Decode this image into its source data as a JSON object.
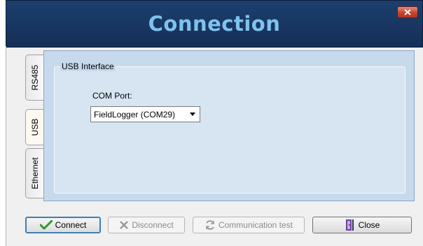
{
  "window": {
    "title": "Connection"
  },
  "tabs": [
    {
      "label": "RS485",
      "active": false
    },
    {
      "label": "USB",
      "active": true
    },
    {
      "label": "Ethernet",
      "active": false
    }
  ],
  "usb": {
    "group_title": "USB Interface",
    "com_port_label": "COM Port:",
    "com_port_value": "FieldLogger (COM29)"
  },
  "buttons": {
    "connect": "Connect",
    "disconnect": "Disconnect",
    "comm_test": "Communication test",
    "close": "Close"
  },
  "colors": {
    "title_bar": "#1c3f6e",
    "title_text": "#7ec3ee",
    "panel": "#c7d9ec",
    "check": "#2f9a2f"
  },
  "icons": {
    "connect": "check-icon",
    "disconnect": "x-icon",
    "comm_test": "refresh-icon",
    "close": "door-exit-icon"
  }
}
